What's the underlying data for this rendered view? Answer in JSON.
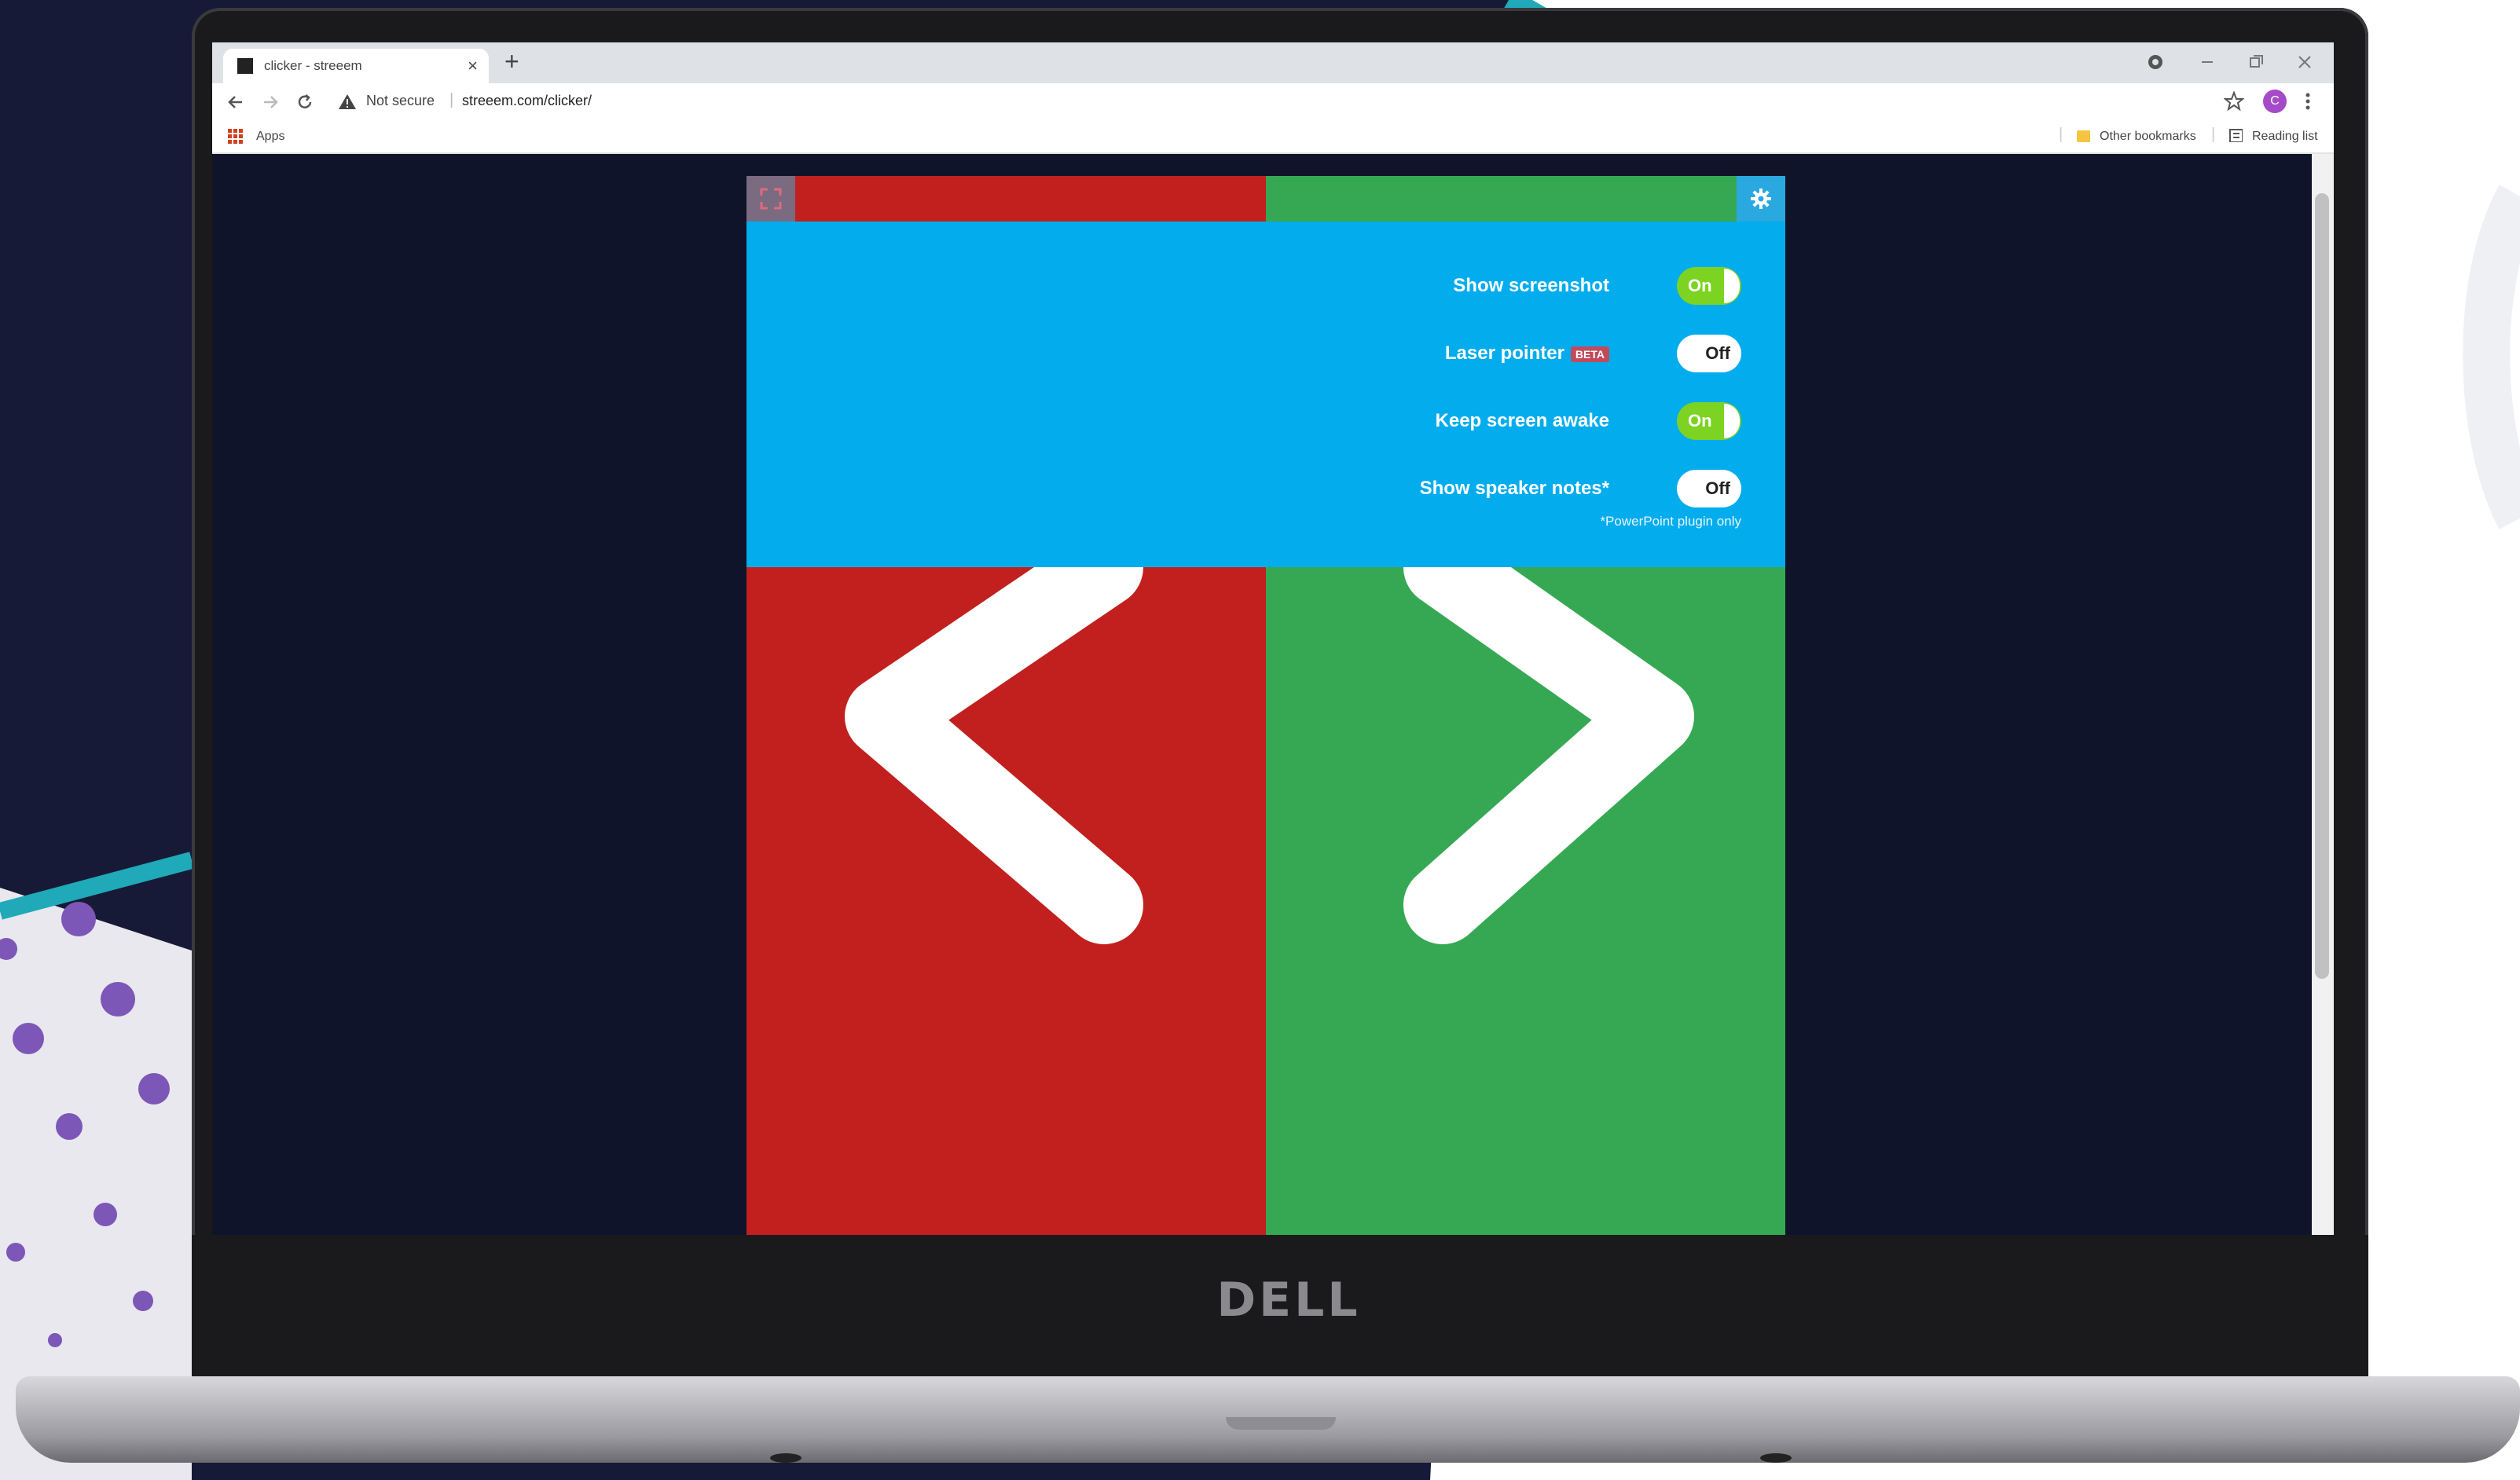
{
  "browser": {
    "tab_title": "clicker - streeem",
    "tab_close": "×",
    "new_tab": "+",
    "security_label": "Not secure",
    "url": "streeem.com/clicker/",
    "profile_initial": "C",
    "bookmarks": {
      "apps": "Apps",
      "other_bookmarks": "Other bookmarks",
      "reading_list": "Reading list"
    }
  },
  "clicker": {
    "settings": [
      {
        "label": "Show screenshot",
        "state": "On"
      },
      {
        "label": "Laser pointer",
        "badge": "BETA",
        "state": "Off"
      },
      {
        "label": "Keep screen awake",
        "state": "On"
      },
      {
        "label": "Show speaker notes*",
        "state": "Off"
      }
    ],
    "plugin_note": "*PowerPoint plugin only",
    "colors": {
      "prev": "#c1201e",
      "next": "#36a854",
      "panel": "#03aced",
      "toggle_on": "#7cd322"
    }
  },
  "laptop": {
    "brand": "DELL"
  },
  "icons": [
    "back-arrow-icon",
    "forward-arrow-icon",
    "reload-icon",
    "warning-icon",
    "star-icon",
    "menu-dots-icon",
    "apps-grid-icon",
    "folder-icon",
    "reading-list-icon",
    "fullscreen-icon",
    "gear-icon",
    "chevron-left-icon",
    "chevron-right-icon"
  ]
}
